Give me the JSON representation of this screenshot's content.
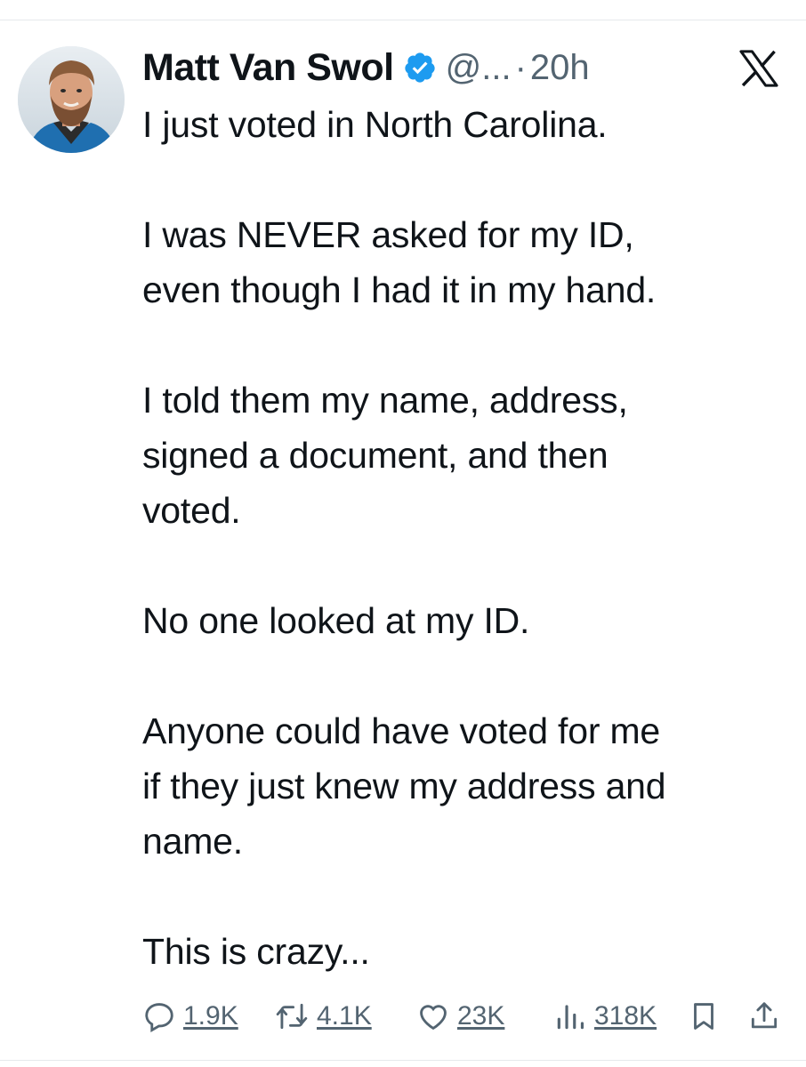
{
  "tweet": {
    "author_name": "Matt Van Swol",
    "handle": "@...",
    "separator": "·",
    "time": "20h",
    "paragraphs": [
      "I just voted in North Carolina.",
      "I was NEVER asked for my ID,\neven though I had it in my hand.",
      "I told them my name, address,\nsigned a document, and then\nvoted.",
      "No one looked at my ID.",
      "Anyone could have voted for me\nif they just knew my address and\nname.",
      "This is crazy..."
    ]
  },
  "actions": {
    "replies": "1.9K",
    "reposts": "4.1K",
    "likes": "23K",
    "views": "318K"
  },
  "icons": {
    "verified": "verified-badge-icon",
    "logo": "x-logo-icon",
    "reply": "reply-icon",
    "repost": "repost-icon",
    "like": "heart-icon",
    "views": "bar-chart-icon",
    "bookmark": "bookmark-icon",
    "share": "share-icon"
  },
  "colors": {
    "text": "#0f1419",
    "secondary": "#536471",
    "verified": "#1d9bf0"
  }
}
